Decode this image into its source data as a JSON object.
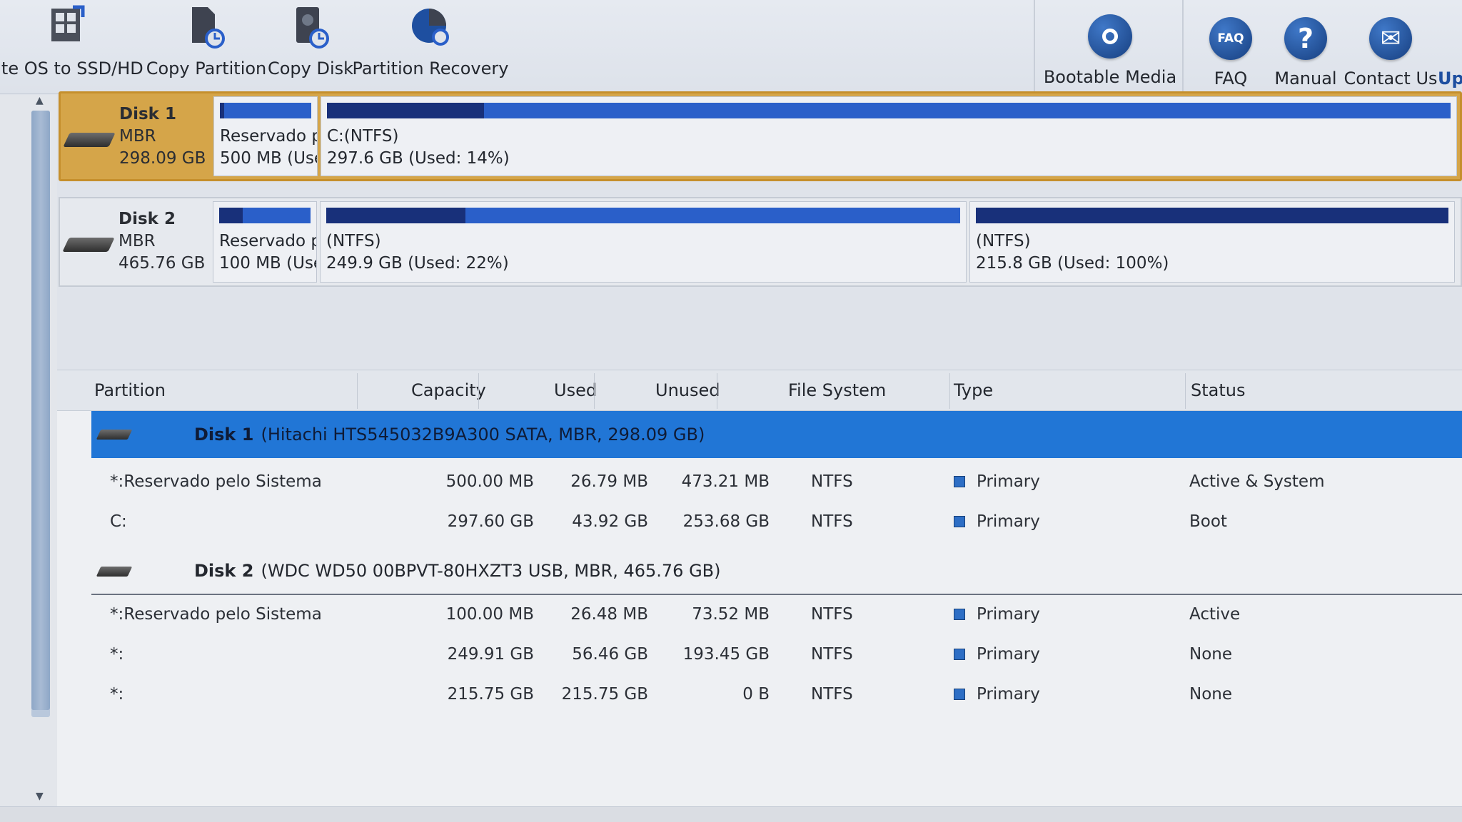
{
  "toolbar": {
    "items": [
      {
        "label": "ate OS to SSD/HD",
        "icon": "migrate-os-icon"
      },
      {
        "label": "Copy Partition",
        "icon": "copy-partition-icon"
      },
      {
        "label": "Copy Disk",
        "icon": "copy-disk-icon"
      },
      {
        "label": "Partition Recovery",
        "icon": "partition-recovery-icon"
      }
    ],
    "bootable_media": {
      "label": "Bootable Media",
      "icon": "disc-icon"
    },
    "help": [
      {
        "label": "FAQ",
        "icon_text": "FAQ",
        "icon": "faq-icon"
      },
      {
        "label": "Manual",
        "icon_text": "?",
        "icon": "question-icon"
      },
      {
        "label": "Contact Us",
        "icon_text": "✉",
        "icon": "mail-icon"
      }
    ],
    "cut_label": "Up"
  },
  "disk_map": {
    "disk1": {
      "name": "Disk 1",
      "scheme": "MBR",
      "size": "298.09 GB",
      "partitions": [
        {
          "line1": "Reservado p",
          "line2": "500 MB (Use",
          "used_fraction": 0.05
        },
        {
          "line1": "C:(NTFS)",
          "line2": "297.6 GB (Used: 14%)",
          "used_fraction": 0.14
        }
      ]
    },
    "disk2": {
      "name": "Disk 2",
      "scheme": "MBR",
      "size": "465.76 GB",
      "partitions": [
        {
          "line1": "Reservado p",
          "line2": "100 MB (Use",
          "used_fraction": 0.26
        },
        {
          "line1": "(NTFS)",
          "line2": "249.9 GB (Used: 22%)",
          "used_fraction": 0.22
        },
        {
          "line1": "(NTFS)",
          "line2": "215.8 GB (Used: 100%)",
          "used_fraction": 1.0
        }
      ]
    }
  },
  "table": {
    "headers": {
      "partition": "Partition",
      "capacity": "Capacity",
      "used": "Used",
      "unused": "Unused",
      "file_system": "File System",
      "type": "Type",
      "status": "Status"
    },
    "disk1": {
      "name": "Disk 1",
      "details": "(Hitachi HTS545032B9A300 SATA, MBR, 298.09 GB)",
      "rows": [
        {
          "partition": "*:Reservado pelo Sistema",
          "capacity": "500.00 MB",
          "used": "26.79 MB",
          "unused": "473.21 MB",
          "fs": "NTFS",
          "type": "Primary",
          "status": "Active & System"
        },
        {
          "partition": "C:",
          "capacity": "297.60 GB",
          "used": "43.92 GB",
          "unused": "253.68 GB",
          "fs": "NTFS",
          "type": "Primary",
          "status": "Boot"
        }
      ]
    },
    "disk2": {
      "name": "Disk 2",
      "details": "(WDC WD50 00BPVT-80HXZT3 USB, MBR, 465.76 GB)",
      "rows": [
        {
          "partition": "*:Reservado pelo Sistema",
          "capacity": "100.00 MB",
          "used": "26.48 MB",
          "unused": "73.52 MB",
          "fs": "NTFS",
          "type": "Primary",
          "status": "Active"
        },
        {
          "partition": "*:",
          "capacity": "249.91 GB",
          "used": "56.46 GB",
          "unused": "193.45 GB",
          "fs": "NTFS",
          "type": "Primary",
          "status": "None"
        },
        {
          "partition": "*:",
          "capacity": "215.75 GB",
          "used": "215.75 GB",
          "unused": "0 B",
          "fs": "NTFS",
          "type": "Primary",
          "status": "None"
        }
      ]
    }
  },
  "colors": {
    "selected_disk": "#d5a549",
    "selected_row": "#2176d6",
    "bar_used": "#18307a",
    "bar_free": "#2a5fc9"
  }
}
